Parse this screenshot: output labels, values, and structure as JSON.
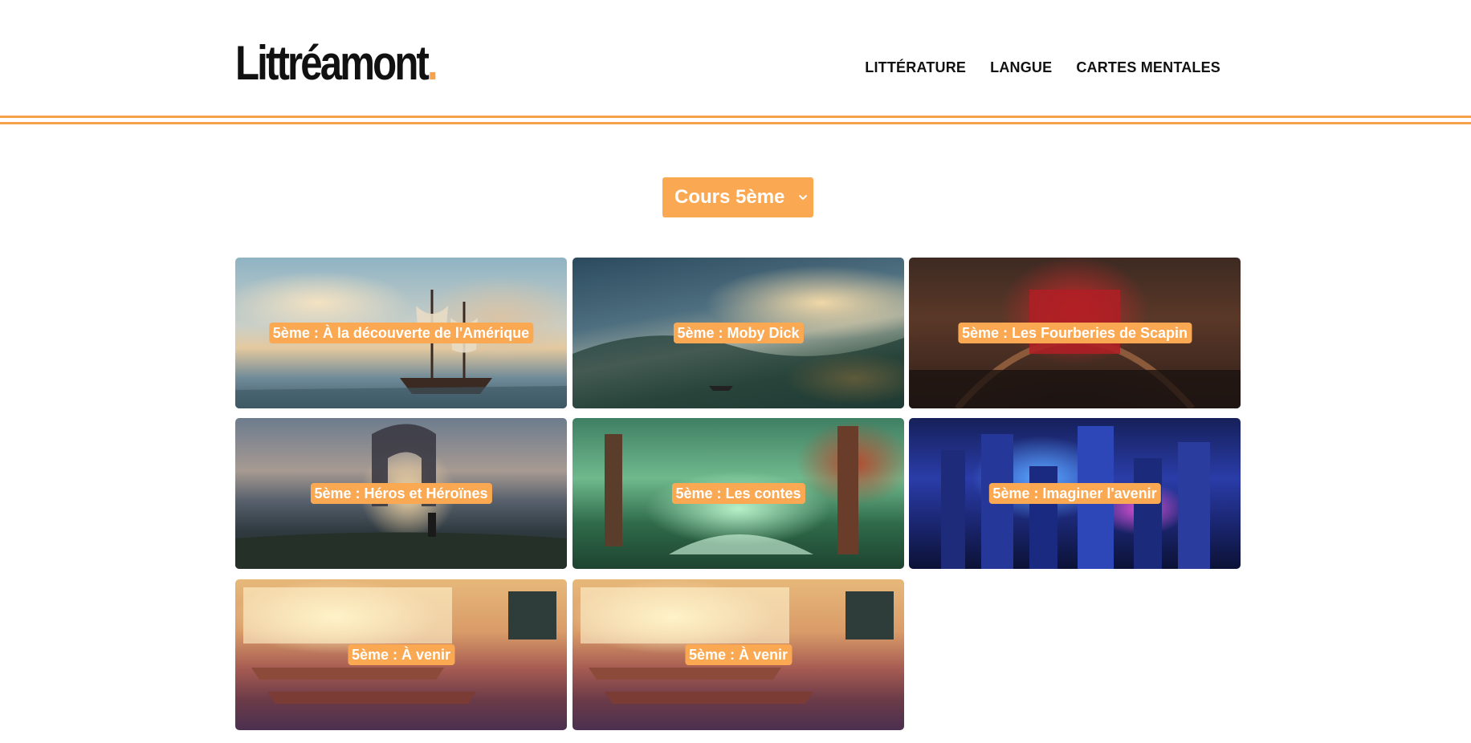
{
  "header": {
    "logo_text": "Littréamont",
    "logo_dot": ".",
    "nav": [
      {
        "label": "LITTÉRATURE"
      },
      {
        "label": "LANGUE"
      },
      {
        "label": "CARTES MENTALES"
      }
    ]
  },
  "colors": {
    "accent": "#fba853",
    "rule": "#f7a24a",
    "text": "#111111"
  },
  "course_select": {
    "value": "Cours 5ème",
    "icon": "chevron-down-icon"
  },
  "cards": [
    {
      "label": "5ème : À la découverte de l'Amérique"
    },
    {
      "label": "5ème : Moby Dick"
    },
    {
      "label": "5ème : Les Fourberies de Scapin"
    },
    {
      "label": "5ème : Héros et Héroïnes"
    },
    {
      "label": "5ème : Les contes"
    },
    {
      "label": "5ème : Imaginer l'avenir"
    },
    {
      "label": "5ème : À venir"
    },
    {
      "label": "5ème : À venir"
    }
  ]
}
